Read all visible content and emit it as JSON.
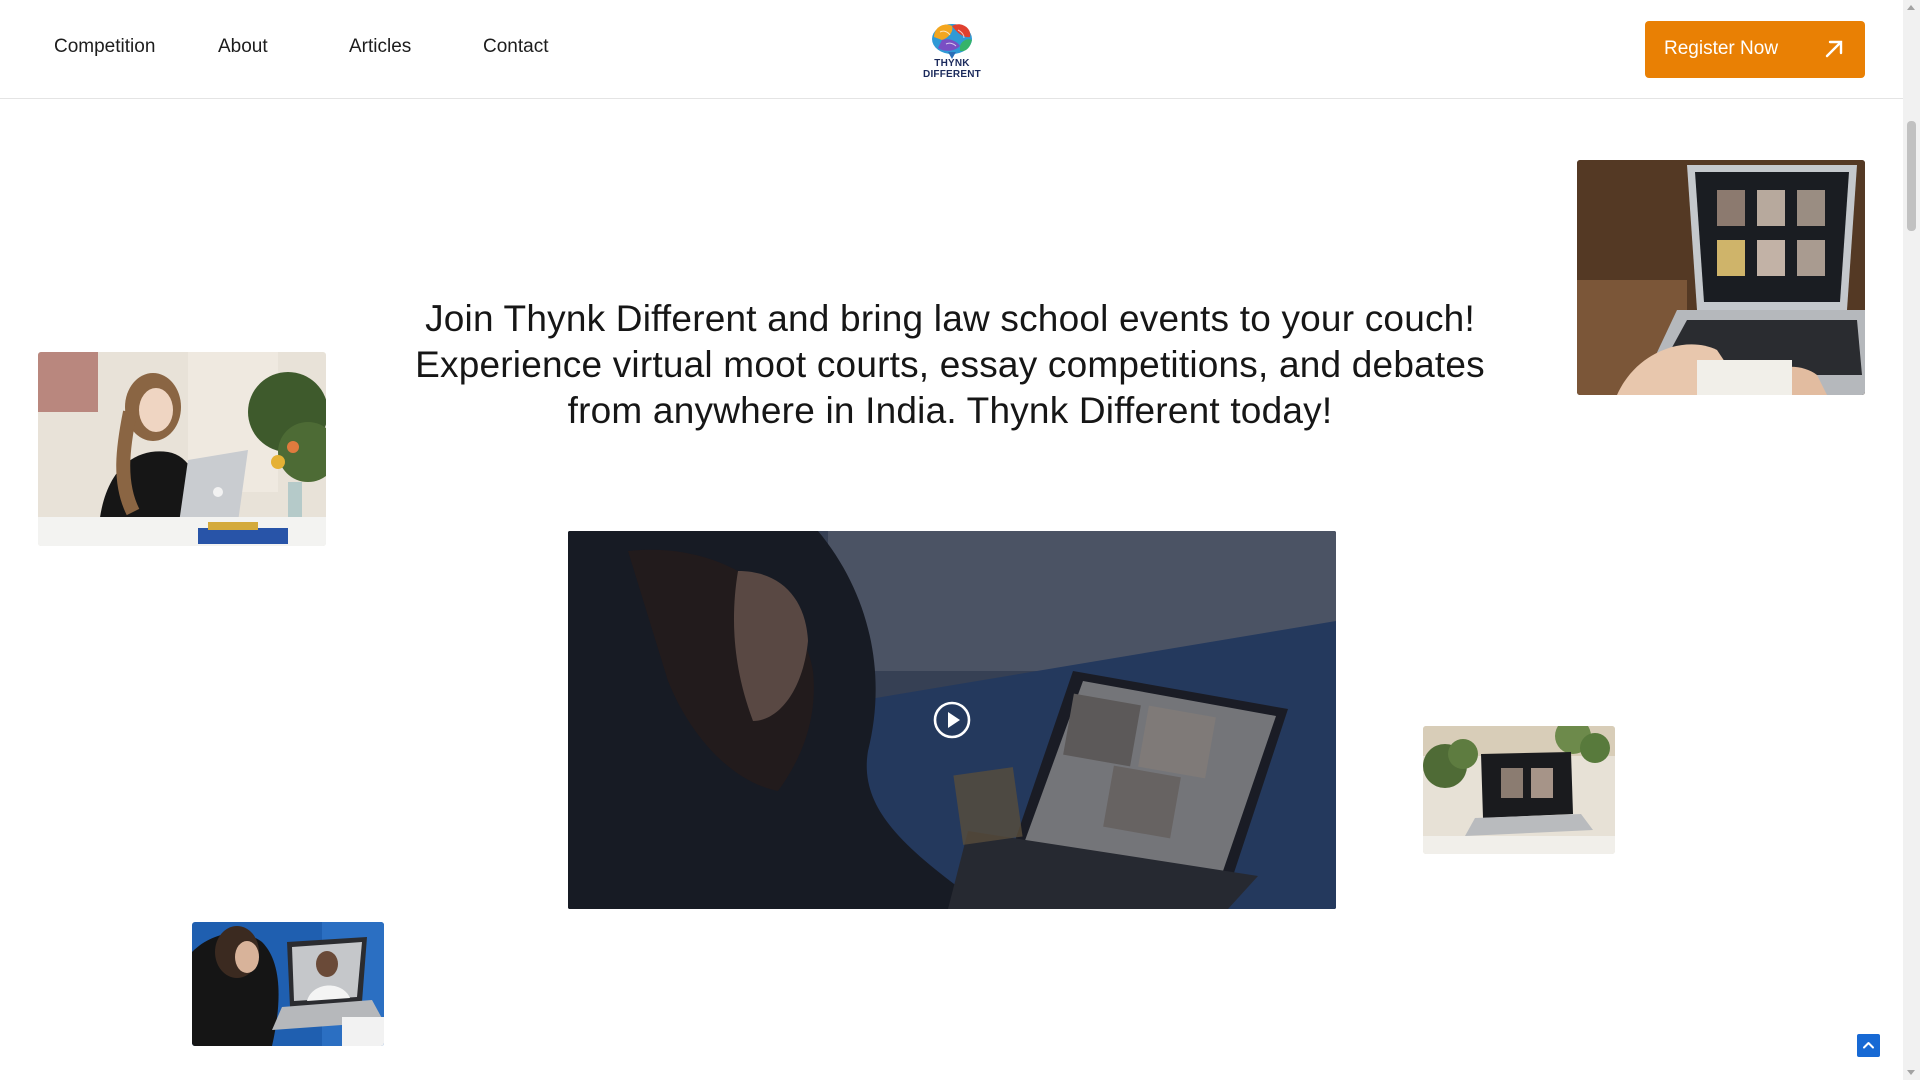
{
  "nav": {
    "items": [
      {
        "label": "Competition"
      },
      {
        "label": "About"
      },
      {
        "label": "Articles"
      },
      {
        "label": "Contact"
      }
    ]
  },
  "brand": {
    "logo_text": "THYNK DIFFERENT",
    "accent_color": "#e98004"
  },
  "header": {
    "register_label": "Register Now"
  },
  "hero": {
    "lines": [
      "Join Thynk Different and bring law school events to your couch!",
      "Experience virtual moot courts, essay competitions, and debates",
      "from anywhere in India. Thynk Different today!"
    ]
  },
  "icons": {
    "register": "arrow-up-right-icon",
    "video": "play-icon",
    "back_to_top": "chevron-up-icon"
  }
}
